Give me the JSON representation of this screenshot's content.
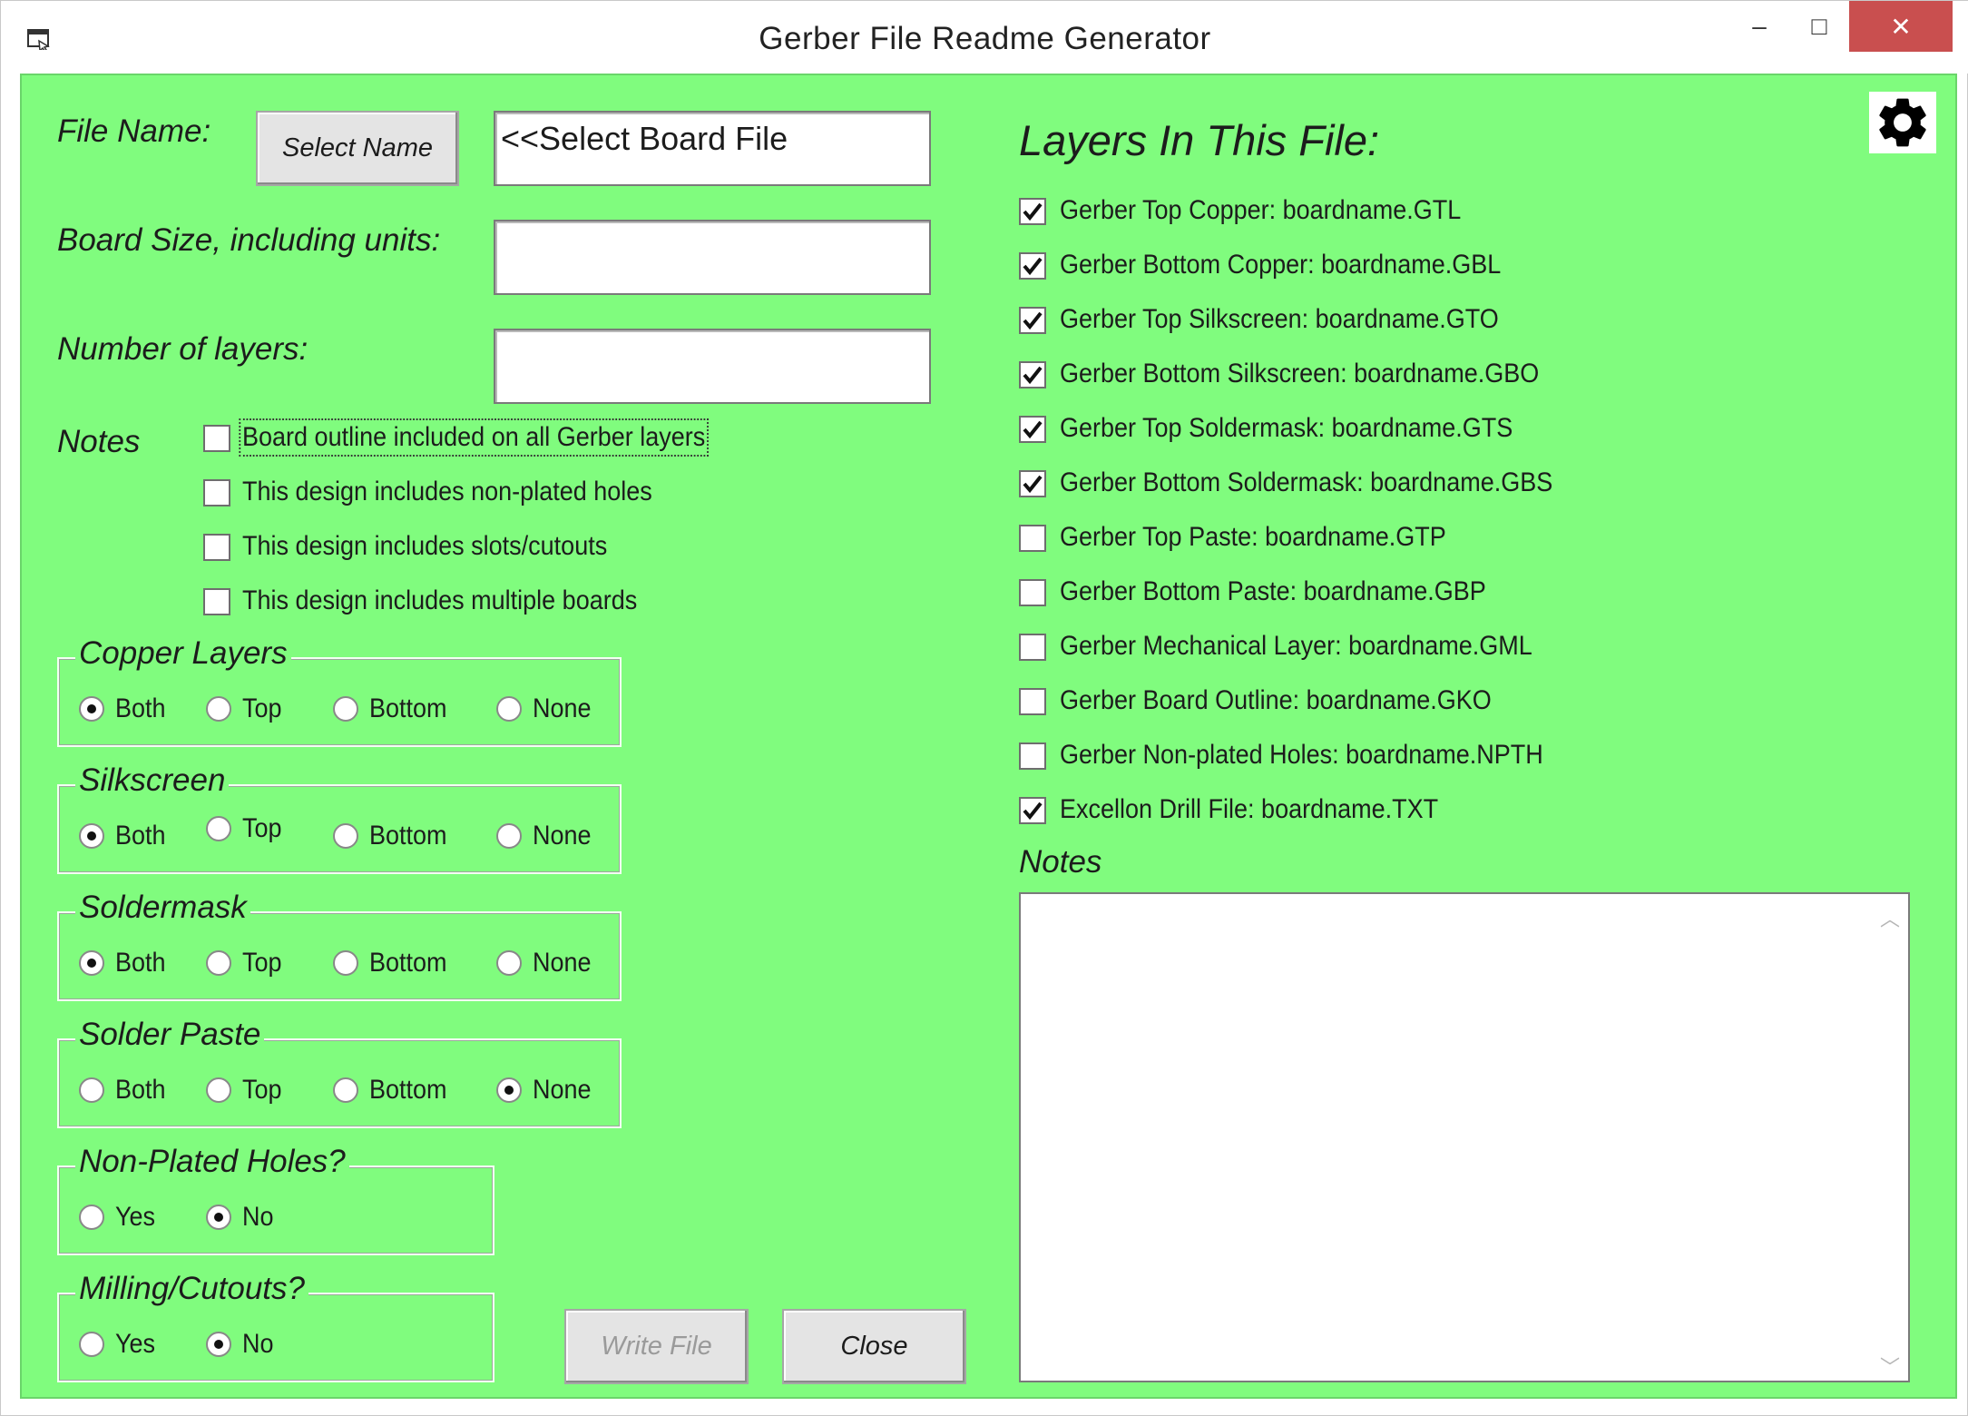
{
  "window": {
    "title": "Gerber File Readme Generator",
    "controls": {
      "minimize": "–",
      "maximize": "□",
      "close": "✕"
    }
  },
  "icons": {
    "app": "window-app-icon",
    "settings": "gear-icon",
    "check": "checkmark-icon"
  },
  "colors": {
    "background": "#80fc7e",
    "close_button": "#c94f4f"
  },
  "form": {
    "file_name_label": "File Name:",
    "select_name_button": "Select Name",
    "file_name_value": "<<Select Board File",
    "board_size_label": "Board Size, including units:",
    "board_size_value": "",
    "num_layers_label": "Number of layers:",
    "num_layers_value": "",
    "notes_label": "Notes",
    "notes_options": [
      {
        "label": "Board outline included on all Gerber layers",
        "checked": false,
        "focused": true
      },
      {
        "label": "This design includes non-plated holes",
        "checked": false
      },
      {
        "label": "This design includes slots/cutouts",
        "checked": false
      },
      {
        "label": "This design includes multiple boards",
        "checked": false
      }
    ]
  },
  "groups": [
    {
      "title": "Copper Layers",
      "options": [
        "Both",
        "Top",
        "Bottom",
        "None"
      ],
      "selected": "Both"
    },
    {
      "title": "Silkscreen",
      "options": [
        "Both",
        "Top",
        "Bottom",
        "None"
      ],
      "selected": "Both"
    },
    {
      "title": "Soldermask",
      "options": [
        "Both",
        "Top",
        "Bottom",
        "None"
      ],
      "selected": "Both"
    },
    {
      "title": "Solder Paste",
      "options": [
        "Both",
        "Top",
        "Bottom",
        "None"
      ],
      "selected": "None"
    },
    {
      "title": "Non-Plated Holes?",
      "options": [
        "Yes",
        "No"
      ],
      "selected": "No"
    },
    {
      "title": "Milling/Cutouts?",
      "options": [
        "Yes",
        "No"
      ],
      "selected": "No"
    }
  ],
  "buttons": {
    "write_file": "Write File",
    "close": "Close"
  },
  "layers": {
    "title": "Layers In This File:",
    "items": [
      {
        "label": "Gerber Top Copper: boardname.GTL",
        "checked": true
      },
      {
        "label": "Gerber Bottom Copper: boardname.GBL",
        "checked": true
      },
      {
        "label": "Gerber Top Silkscreen: boardname.GTO",
        "checked": true
      },
      {
        "label": "Gerber Bottom Silkscreen: boardname.GBO",
        "checked": true
      },
      {
        "label": "Gerber Top Soldermask: boardname.GTS",
        "checked": true
      },
      {
        "label": "Gerber Bottom Soldermask: boardname.GBS",
        "checked": true
      },
      {
        "label": "Gerber Top Paste: boardname.GTP",
        "checked": false
      },
      {
        "label": "Gerber Bottom Paste: boardname.GBP",
        "checked": false
      },
      {
        "label": "Gerber Mechanical Layer: boardname.GML",
        "checked": false
      },
      {
        "label": "Gerber Board Outline: boardname.GKO",
        "checked": false
      },
      {
        "label": "Gerber Non-plated Holes: boardname.NPTH",
        "checked": false
      },
      {
        "label": "Excellon Drill File: boardname.TXT",
        "checked": true
      }
    ],
    "notes_label": "Notes",
    "notes_value": ""
  }
}
